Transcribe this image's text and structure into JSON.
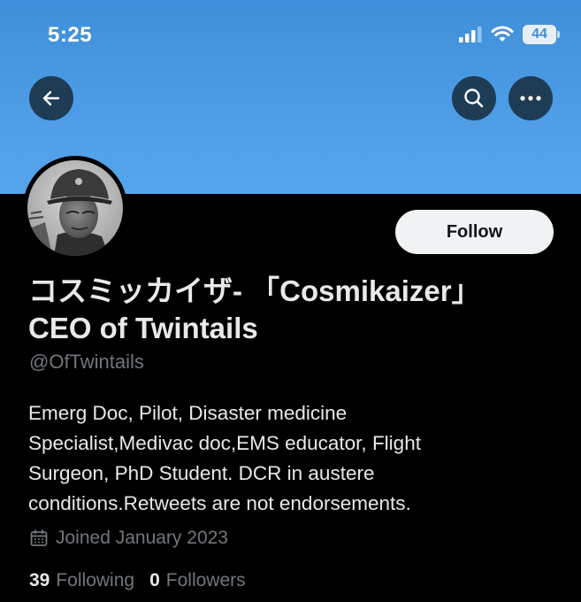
{
  "status_bar": {
    "time": "5:25",
    "battery": "44"
  },
  "profile": {
    "display_name_line1": "コスミッカイザ- 「Cosmikaizer」",
    "display_name_line2": "CEO of Twintails",
    "handle": "@OfTwintails",
    "bio_lines": [
      "Emerg Doc, Pilot, Disaster medicine",
      "Specialist,Medivac doc,EMS educator, Flight",
      "Surgeon, PhD Student. DCR in austere",
      "conditions.Retweets are not endorsements."
    ],
    "joined": "Joined January 2023",
    "following_count": "39",
    "following_label": "Following",
    "followers_count": "0",
    "followers_label": "Followers"
  },
  "actions": {
    "follow_label": "Follow"
  },
  "icons": {
    "back": "arrow-left-icon",
    "search": "search-icon",
    "more": "more-horizontal-icon",
    "calendar": "calendar-icon"
  },
  "colors": {
    "banner": "#4e9de6",
    "background": "#000000",
    "text": "#e7e9ea",
    "muted": "#71767b",
    "follow_bg": "#eff3f4"
  }
}
